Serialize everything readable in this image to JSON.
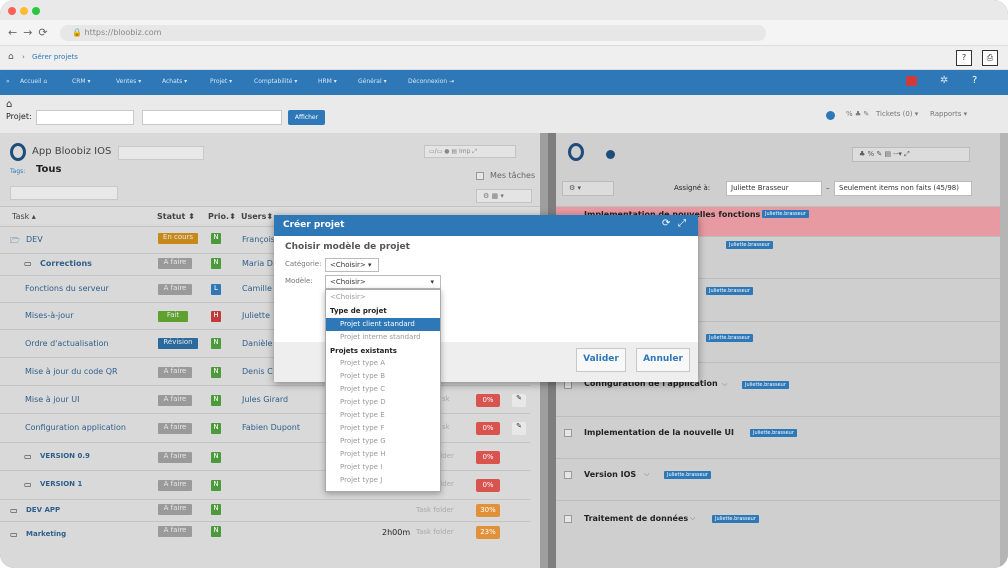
{
  "browser": {
    "url": "https://bloobiz.com"
  },
  "crumb": {
    "text": "Gérer projets"
  },
  "menu": [
    "Accueil",
    "CRM",
    "Ventes",
    "Achats",
    "Projet",
    "Comptabilité",
    "HRM",
    "Général",
    "Déconnexion"
  ],
  "projbar": {
    "label": "Projet:",
    "afficher": "Afficher",
    "tickets": "Tickets (0)",
    "rapports": "Rapports"
  },
  "left": {
    "app_title": "App Bloobiz IOS",
    "tags_label": "Tags:",
    "tags_value": "Tous",
    "mes_taches": "Mes tâches",
    "headers": {
      "task": "Task",
      "statut": "Statut",
      "prio": "Prio.",
      "users": "Users"
    },
    "rows": [
      {
        "name": "DEV",
        "statut": "En cours",
        "prio": "N",
        "user": "François",
        "pct": "",
        "folder": ""
      },
      {
        "name": "Corrections",
        "statut": "A faire",
        "prio": "N",
        "user": "Maria D",
        "pct": "",
        "folder": ""
      },
      {
        "name": "Fonctions du serveur",
        "statut": "A faire",
        "prio": "L",
        "user": "Camille",
        "pct": "",
        "folder": ""
      },
      {
        "name": "Mises-à-jour",
        "statut": "Fait",
        "prio": "H",
        "user": "Juliette",
        "pct": "",
        "folder": ""
      },
      {
        "name": "Ordre d'actualisation",
        "statut": "Révision",
        "prio": "N",
        "user": "Danièle",
        "pct": "",
        "folder": ""
      },
      {
        "name": "Mise à jour du code QR",
        "statut": "A faire",
        "prio": "N",
        "user": "Denis C",
        "pct": "",
        "folder": ""
      },
      {
        "name": "Mise à jour UI",
        "statut": "A faire",
        "prio": "N",
        "user": "Jules Girard",
        "pct": "0%",
        "folder": "sk"
      },
      {
        "name": "Configuration application",
        "statut": "A faire",
        "prio": "N",
        "user": "Fabien Dupont",
        "pct": "0%",
        "folder": "sk"
      },
      {
        "name": "VERSION 0.9",
        "statut": "A faire",
        "prio": "N",
        "user": "",
        "pct": "0%",
        "folder": "older"
      },
      {
        "name": "VERSION 1",
        "statut": "A faire",
        "prio": "N",
        "user": "",
        "pct": "0%",
        "folder": "older"
      },
      {
        "name": "DEV APP",
        "statut": "A faire",
        "prio": "N",
        "user": "",
        "pct": "30%",
        "folder": "Task folder"
      },
      {
        "name": "Marketing",
        "statut": "A faire",
        "prio": "N",
        "user": "",
        "pct": "23%",
        "folder": "Task folder",
        "time": "2h00m"
      }
    ]
  },
  "right": {
    "assigne_label": "Assigné à:",
    "assigne_value": "Juliette Brasseur",
    "filter_value": "Seulement items non faits (45/98)",
    "tag": "Juliette.brasseur",
    "rows": [
      {
        "text": "Implementation de nouvelles fonctions"
      },
      {
        "text": ""
      },
      {
        "text": ""
      },
      {
        "text": ""
      },
      {
        "text": "Configuration de l'application"
      },
      {
        "text": "Implementation de la nouvelle UI"
      },
      {
        "text": "Version IOS"
      },
      {
        "text": "Traitement de données"
      }
    ]
  },
  "modal": {
    "title": "Créer projet",
    "subtitle": "Choisir modèle de projet",
    "categorie_label": "Catégorie:",
    "categorie_value": "<Choisir>",
    "modele_label": "Modèle:",
    "modele_value": "<Choisir>",
    "valider": "Valider",
    "annuler": "Annuler"
  },
  "dropdown": {
    "placeholder": "<Choisir>",
    "group1": "Type de projet",
    "group1_items": [
      "Projet client standard",
      "Projet interne standard"
    ],
    "group2": "Projets existants",
    "group2_items": [
      "Projet type A",
      "Projet type B",
      "Projet type C",
      "Projet type D",
      "Projet type E",
      "Projet type F",
      "Projet type G",
      "Projet type H",
      "Projet type I",
      "Projet type J"
    ]
  },
  "colors": {
    "accent": "#2e78b8",
    "en_cours": "#c7891a",
    "fait": "#5fa12f",
    "revision": "#2a6a9c",
    "prio_n": "#4d9a3a",
    "prio_l": "#2e78b8",
    "prio_h": "#c23a3a",
    "pct_red": "#d9534f",
    "pct_orange": "#e0913a"
  }
}
